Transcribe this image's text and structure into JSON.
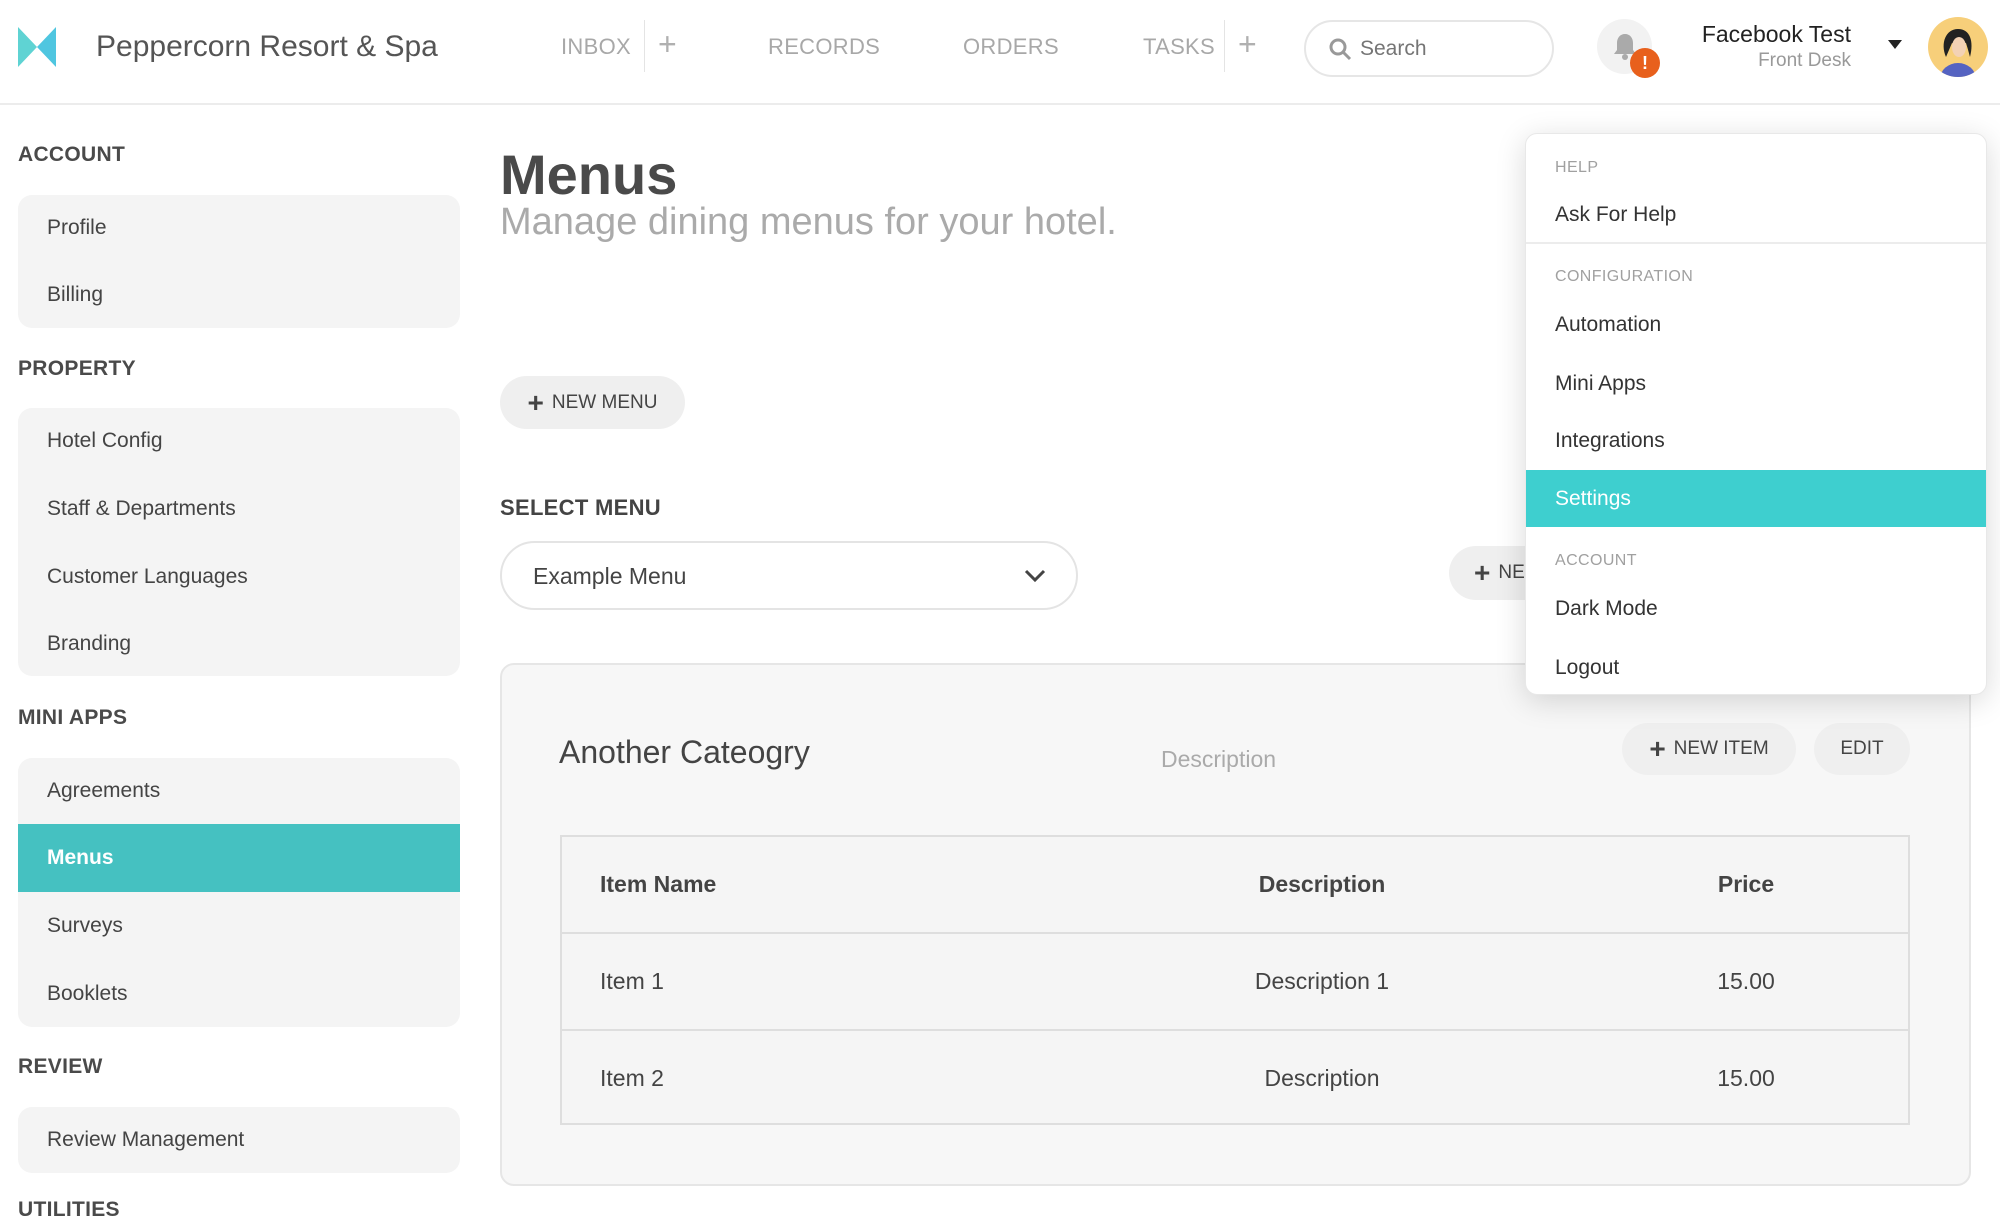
{
  "app": {
    "title": "Peppercorn Resort & Spa",
    "brand_color": "#4fd1d9"
  },
  "nav": {
    "items": [
      {
        "label": "INBOX"
      },
      {
        "label": "RECORDS"
      },
      {
        "label": "ORDERS"
      },
      {
        "label": "TASKS"
      }
    ],
    "plus": "+"
  },
  "search": {
    "placeholder": "Search"
  },
  "notifications": {
    "badge": "!",
    "badge_color": "#e8601c"
  },
  "user": {
    "name": "Facebook Test",
    "role": "Front Desk"
  },
  "sidebar": {
    "sections": [
      {
        "title": "ACCOUNT",
        "items": [
          {
            "label": "Profile"
          },
          {
            "label": "Billing"
          }
        ]
      },
      {
        "title": "PROPERTY",
        "items": [
          {
            "label": "Hotel Config"
          },
          {
            "label": "Staff & Departments"
          },
          {
            "label": "Customer Languages"
          },
          {
            "label": "Branding"
          }
        ]
      },
      {
        "title": "MINI APPS",
        "items": [
          {
            "label": "Agreements"
          },
          {
            "label": "Menus",
            "active": true
          },
          {
            "label": "Surveys"
          },
          {
            "label": "Booklets"
          }
        ]
      },
      {
        "title": "REVIEW",
        "items": [
          {
            "label": "Review Management"
          }
        ]
      },
      {
        "title": "UTILITIES",
        "items": []
      }
    ],
    "active_color": "#45c1c1"
  },
  "page": {
    "title": "Menus",
    "subtitle": "Manage dining menus for your hotel.",
    "new_menu": "NEW MENU",
    "select_label": "SELECT MENU",
    "selected_menu": "Example Menu",
    "new_category_partial": "NE"
  },
  "category": {
    "name": "Another Cateogry",
    "description_placeholder": "Description",
    "new_item": "NEW ITEM",
    "edit": "EDIT",
    "columns": [
      "Item Name",
      "Description",
      "Price"
    ],
    "rows": [
      [
        "Item 1",
        "Description 1",
        "15.00"
      ],
      [
        "Item 2",
        "Description",
        "15.00"
      ]
    ]
  },
  "user_menu": {
    "sections": [
      {
        "title": "HELP",
        "items": [
          {
            "label": "Ask For Help"
          }
        ]
      },
      {
        "title": "CONFIGURATION",
        "items": [
          {
            "label": "Automation"
          },
          {
            "label": "Mini Apps"
          },
          {
            "label": "Integrations"
          },
          {
            "label": "Settings",
            "active": true
          }
        ]
      },
      {
        "title": "ACCOUNT",
        "items": [
          {
            "label": "Dark Mode"
          },
          {
            "label": "Logout"
          }
        ]
      }
    ],
    "active_color": "#3ecfcf"
  }
}
